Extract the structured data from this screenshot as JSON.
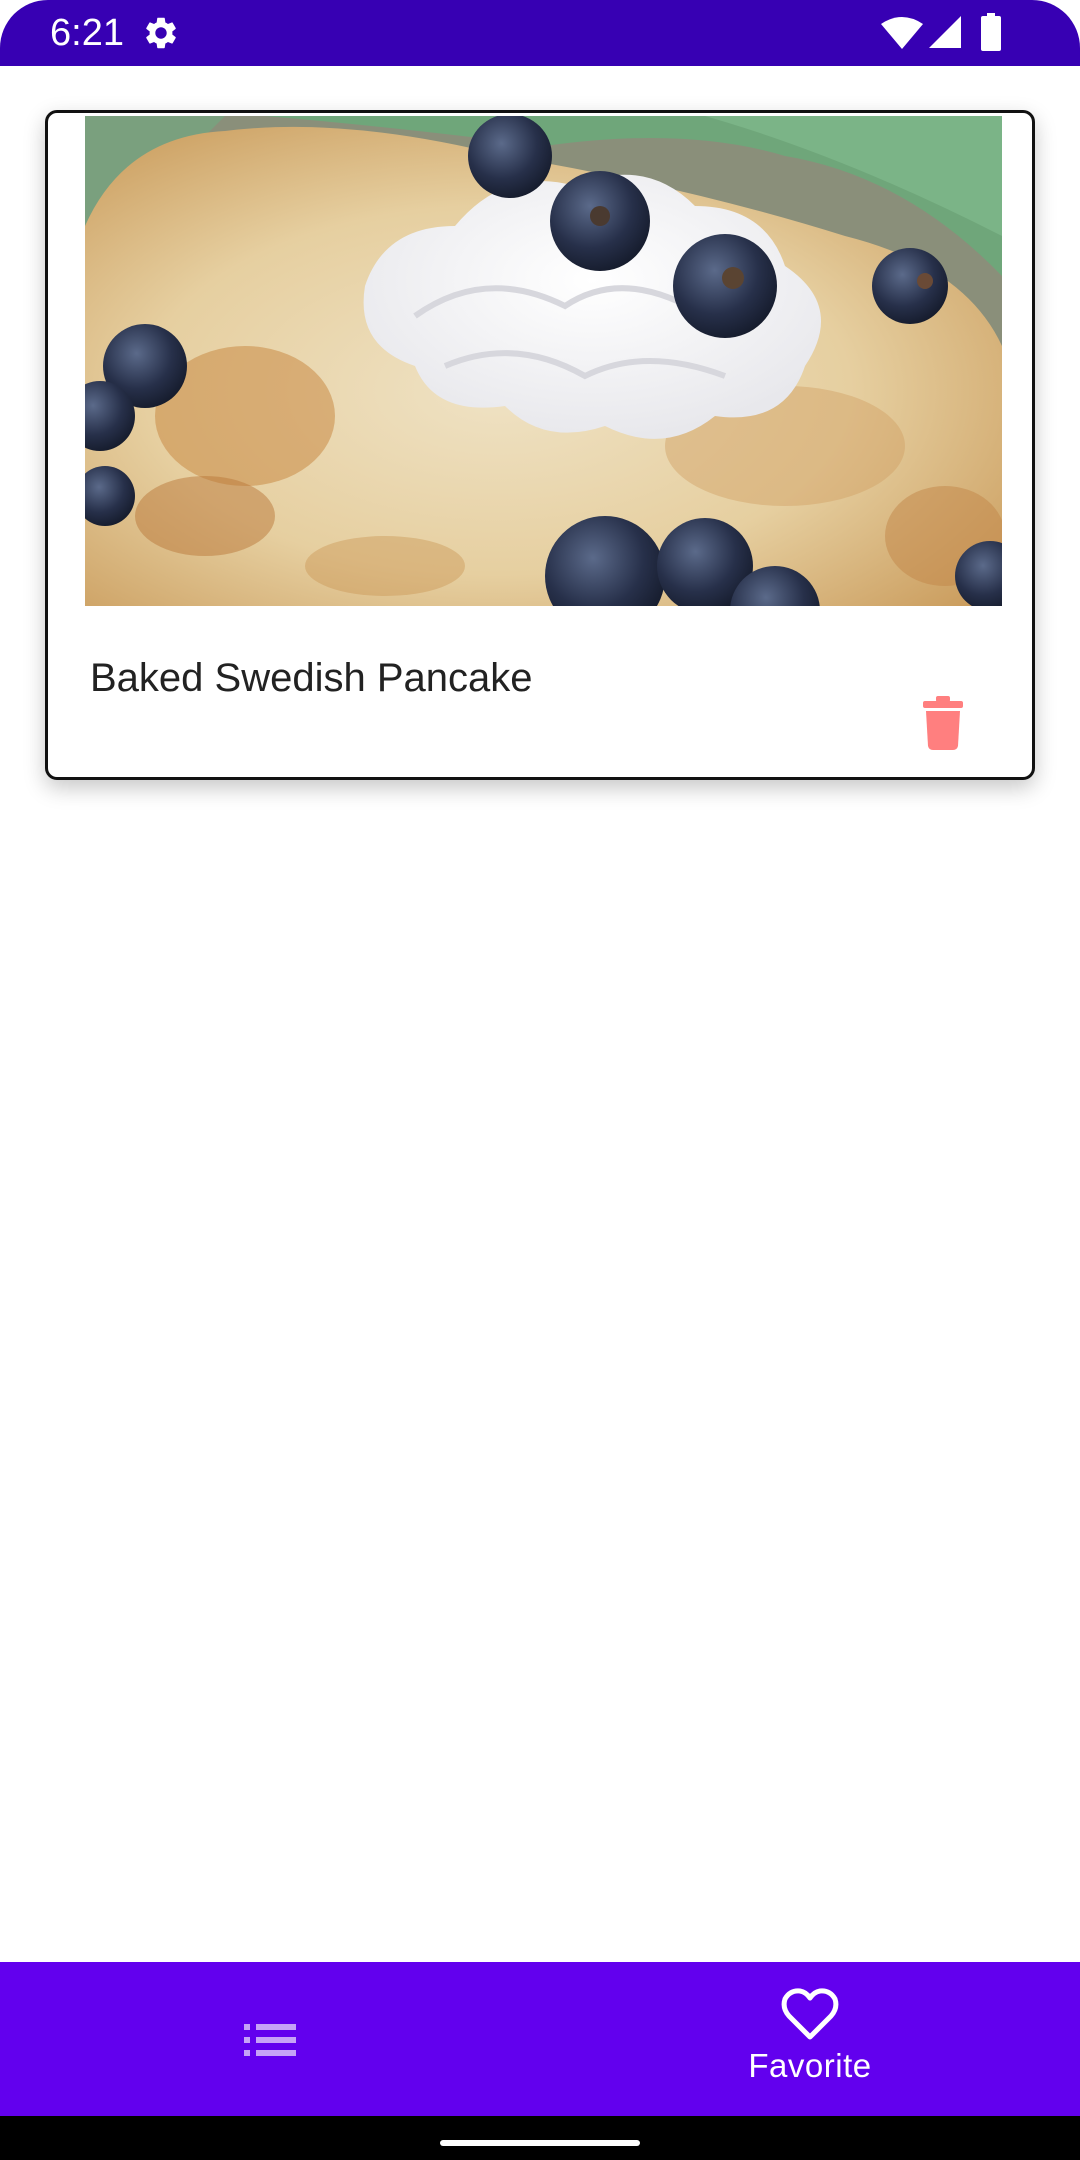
{
  "status_bar": {
    "time": "6:21",
    "background": "#3700B3",
    "icons": [
      "gear-icon",
      "wifi-icon",
      "cell-signal-icon",
      "battery-icon"
    ]
  },
  "favorites": [
    {
      "title": "Baked Swedish Pancake",
      "image": "food-photo",
      "delete_icon": "trash-icon",
      "delete_color": "#FF7F7F"
    }
  ],
  "bottom_nav": {
    "background": "#6200EE",
    "items": [
      {
        "icon": "list-icon",
        "label": ""
      },
      {
        "icon": "heart-icon",
        "label": "Favorite",
        "selected": true
      }
    ]
  }
}
